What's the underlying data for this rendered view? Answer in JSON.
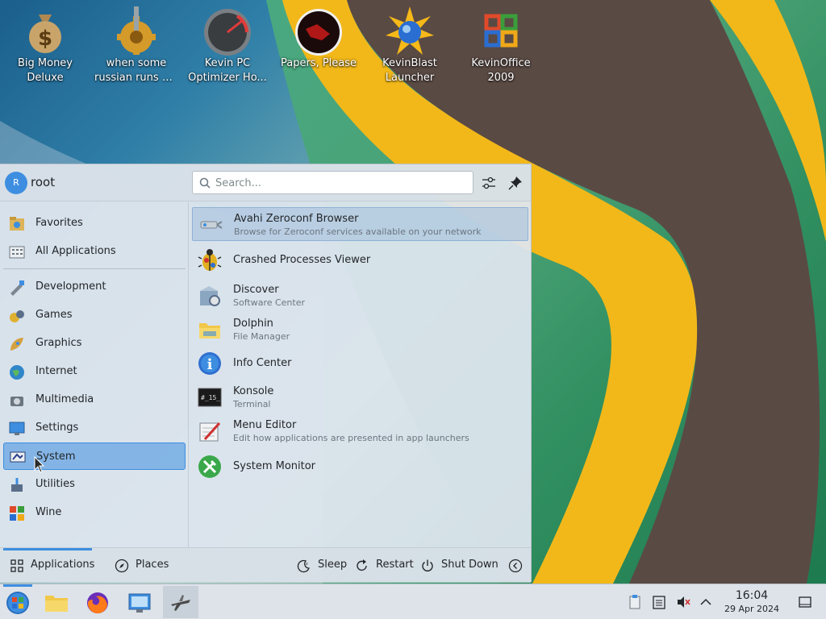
{
  "desktop": {
    "icons": [
      {
        "label_line1": "Big Money",
        "label_line2": "Deluxe",
        "icon": "money-bag-icon"
      },
      {
        "label_line1": "when some",
        "label_line2": "russian runs a...",
        "icon": "gear-icon"
      },
      {
        "label_line1": "Kevin PC",
        "label_line2": "Optimizer Ho...",
        "icon": "speedometer-icon"
      },
      {
        "label_line1": "Papers, Please",
        "label_line2": "",
        "icon": "papers-please-icon"
      },
      {
        "label_line1": "KevinBlast",
        "label_line2": "Launcher",
        "icon": "starburst-icon"
      },
      {
        "label_line1": "KevinOffice",
        "label_line2": "2009",
        "icon": "office-icon"
      }
    ]
  },
  "menu": {
    "user": {
      "initial": "R",
      "name": "root"
    },
    "search_placeholder": "Search...",
    "categories": [
      {
        "label": "Favorites",
        "icon": "favorites-icon"
      },
      {
        "label": "All Applications",
        "icon": "all-applications-icon"
      },
      {
        "label": "Development",
        "icon": "development-icon"
      },
      {
        "label": "Games",
        "icon": "games-icon"
      },
      {
        "label": "Graphics",
        "icon": "graphics-icon"
      },
      {
        "label": "Internet",
        "icon": "internet-icon"
      },
      {
        "label": "Multimedia",
        "icon": "multimedia-icon"
      },
      {
        "label": "Settings",
        "icon": "settings-icon"
      },
      {
        "label": "System",
        "icon": "system-icon"
      },
      {
        "label": "Utilities",
        "icon": "utilities-icon"
      },
      {
        "label": "Wine",
        "icon": "wine-icon"
      }
    ],
    "selected_category": "System",
    "apps": [
      {
        "name": "Avahi Zeroconf Browser",
        "desc": "Browse for Zeroconf services available on your network",
        "icon": "network-icon"
      },
      {
        "name": "Crashed Processes Viewer",
        "desc": "",
        "icon": "bug-icon"
      },
      {
        "name": "Discover",
        "desc": "Software Center",
        "icon": "discover-icon"
      },
      {
        "name": "Dolphin",
        "desc": "File Manager",
        "icon": "folder-icon"
      },
      {
        "name": "Info Center",
        "desc": "",
        "icon": "info-icon"
      },
      {
        "name": "Konsole",
        "desc": "Terminal",
        "icon": "terminal-icon"
      },
      {
        "name": "Menu Editor",
        "desc": "Edit how applications are presented in app launchers",
        "icon": "menu-editor-icon"
      },
      {
        "name": "System Monitor",
        "desc": "",
        "icon": "system-monitor-icon"
      }
    ],
    "footer": {
      "applications": "Applications",
      "places": "Places",
      "sleep": "Sleep",
      "restart": "Restart",
      "shutdown": "Shut Down"
    }
  },
  "taskbar": {
    "clock_time": "16:04",
    "clock_date": "29 Apr 2024"
  },
  "colors": {
    "accent": "#3d8ee0",
    "menu_bg": "#dee6ee",
    "taskbar_bg": "#dde3e9"
  }
}
